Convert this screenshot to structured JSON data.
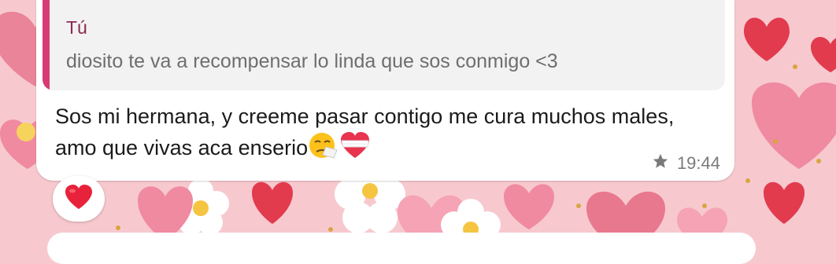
{
  "quoted_message": {
    "author": "Tú",
    "text": "diosito te va a recompensar lo linda que sos conmigo <3"
  },
  "message": {
    "text": "Sos mi hermana, y creeme pasar contigo me cura muchos males, amo que vivas aca enserio",
    "emojis": [
      "sneezing-face-emoji",
      "mending-heart-emoji"
    ],
    "time": "19:44",
    "starred": true
  },
  "reaction": {
    "emoji": "red-heart-emoji"
  },
  "colors": {
    "quote_bar": "#d83a76",
    "quote_author": "#8a2a52",
    "wallpaper": "#f7c9cf"
  }
}
